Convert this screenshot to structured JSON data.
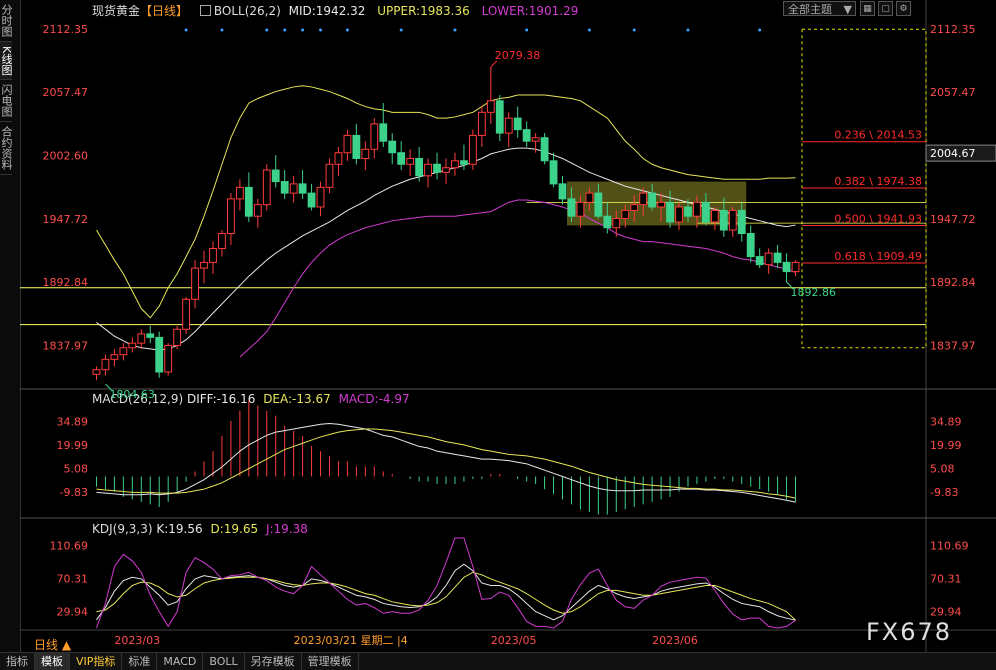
{
  "sidebar_tabs": [
    "分时图",
    "K线图",
    "闪电图",
    "合约资料"
  ],
  "active_sidebar_tab": 1,
  "header": {
    "symbol": "现货黄金",
    "period": "【日线】",
    "boll_label": "BOLL(26,2)",
    "mid": "MID:1942.32",
    "upper": "UPPER:1983.36",
    "lower": "LOWER:1901.29",
    "theme_label": "全部主题"
  },
  "macd_header": {
    "label": "MACD(26,12,9)",
    "diff": "DIFF:-16.16",
    "dea": "DEA:-13.67",
    "macd": "MACD:-4.97"
  },
  "kdj_header": {
    "label": "KDJ(9,3,3)",
    "k": "K:19.56",
    "d": "D:19.65",
    "j": "J:19.38"
  },
  "x_axis": {
    "period_label": "日线",
    "labels": [
      "2023/03",
      "2023/03/21 星期二 |4",
      "2023/05",
      "2023/06"
    ]
  },
  "bottom_tabs": [
    "指标",
    "模板",
    "VIP指标",
    "标准",
    "MACD",
    "BOLL",
    "另存模板",
    "管理模板"
  ],
  "active_bottom_tab": 1,
  "watermark": "FX678",
  "current_price_tag": "2004.67",
  "colors": {
    "up": "#ff3b3b",
    "down": "#3dd28c",
    "mid": "#e8e8e8",
    "upper": "#e6e65a",
    "lower": "#d23cd2",
    "fib": "#ff2b2b",
    "level": "#ffff66",
    "axis_text": "#ff4d4d",
    "box": "#6b6b1f"
  },
  "chart_data": {
    "type": "candlestick",
    "main": {
      "y_ticks": [
        2112.35,
        2057.47,
        2002.6,
        1947.72,
        1892.84,
        1837.97
      ],
      "ylim": [
        1815,
        2120
      ],
      "candles_ohlc": [
        [
          1813,
          1820,
          1808,
          1817
        ],
        [
          1817,
          1830,
          1812,
          1826
        ],
        [
          1826,
          1835,
          1820,
          1830
        ],
        [
          1830,
          1840,
          1825,
          1836
        ],
        [
          1836,
          1845,
          1832,
          1840
        ],
        [
          1840,
          1852,
          1835,
          1848
        ],
        [
          1848,
          1855,
          1840,
          1845
        ],
        [
          1845,
          1850,
          1810,
          1815
        ],
        [
          1815,
          1840,
          1812,
          1838
        ],
        [
          1838,
          1855,
          1835,
          1852
        ],
        [
          1852,
          1880,
          1848,
          1878
        ],
        [
          1878,
          1912,
          1870,
          1905
        ],
        [
          1905,
          1920,
          1892,
          1910
        ],
        [
          1910,
          1928,
          1900,
          1922
        ],
        [
          1922,
          1938,
          1915,
          1935
        ],
        [
          1935,
          1970,
          1925,
          1965
        ],
        [
          1965,
          1982,
          1955,
          1975
        ],
        [
          1975,
          1988,
          1945,
          1950
        ],
        [
          1950,
          1965,
          1940,
          1960
        ],
        [
          1960,
          1995,
          1955,
          1990
        ],
        [
          1990,
          2003,
          1975,
          1980
        ],
        [
          1980,
          1990,
          1965,
          1970
        ],
        [
          1970,
          1985,
          1962,
          1978
        ],
        [
          1978,
          1990,
          1965,
          1970
        ],
        [
          1970,
          1978,
          1955,
          1958
        ],
        [
          1958,
          1980,
          1950,
          1975
        ],
        [
          1975,
          2000,
          1970,
          1995
        ],
        [
          1995,
          2010,
          1985,
          2005
        ],
        [
          2005,
          2025,
          1998,
          2020
        ],
        [
          2020,
          2030,
          1995,
          2000
        ],
        [
          2000,
          2015,
          1990,
          2008
        ],
        [
          2008,
          2035,
          2000,
          2030
        ],
        [
          2030,
          2048,
          2010,
          2015
        ],
        [
          2015,
          2022,
          1995,
          2005
        ],
        [
          2005,
          2015,
          1990,
          1995
        ],
        [
          1995,
          2008,
          1985,
          2000
        ],
        [
          2000,
          2010,
          1980,
          1985
        ],
        [
          1985,
          2000,
          1975,
          1995
        ],
        [
          1995,
          2005,
          1982,
          1988
        ],
        [
          1988,
          2000,
          1978,
          1992
        ],
        [
          1992,
          2005,
          1985,
          1998
        ],
        [
          1998,
          2012,
          1990,
          1995
        ],
        [
          1995,
          2025,
          1990,
          2020
        ],
        [
          2020,
          2045,
          2010,
          2040
        ],
        [
          2040,
          2079.38,
          2030,
          2050
        ],
        [
          2050,
          2055,
          2015,
          2022
        ],
        [
          2022,
          2040,
          2010,
          2035
        ],
        [
          2035,
          2045,
          2018,
          2025
        ],
        [
          2025,
          2032,
          2010,
          2015
        ],
        [
          2015,
          2022,
          2005,
          2018
        ],
        [
          2018,
          2022,
          1995,
          1998
        ],
        [
          1998,
          2005,
          1975,
          1978
        ],
        [
          1978,
          1985,
          1960,
          1965
        ],
        [
          1965,
          1975,
          1945,
          1950
        ],
        [
          1950,
          1968,
          1940,
          1962
        ],
        [
          1962,
          1975,
          1955,
          1970
        ],
        [
          1970,
          1978,
          1948,
          1950
        ],
        [
          1950,
          1962,
          1935,
          1940
        ],
        [
          1940,
          1955,
          1932,
          1948
        ],
        [
          1948,
          1960,
          1940,
          1955
        ],
        [
          1955,
          1968,
          1945,
          1960
        ],
        [
          1960,
          1975,
          1950,
          1970
        ],
        [
          1970,
          1978,
          1955,
          1958
        ],
        [
          1958,
          1970,
          1945,
          1962
        ],
        [
          1962,
          1972,
          1940,
          1945
        ],
        [
          1945,
          1962,
          1938,
          1958
        ],
        [
          1958,
          1965,
          1945,
          1950
        ],
        [
          1950,
          1968,
          1940,
          1962
        ],
        [
          1962,
          1970,
          1942,
          1945
        ],
        [
          1945,
          1958,
          1938,
          1955
        ],
        [
          1955,
          1966,
          1932,
          1938
        ],
        [
          1938,
          1958,
          1932,
          1955
        ],
        [
          1955,
          1962,
          1928,
          1935
        ],
        [
          1935,
          1942,
          1910,
          1915
        ],
        [
          1915,
          1922,
          1905,
          1908
        ],
        [
          1908,
          1922,
          1900,
          1918
        ],
        [
          1918,
          1925,
          1905,
          1910
        ],
        [
          1910,
          1918,
          1892.86,
          1902
        ],
        [
          1902,
          1912,
          1898,
          1910
        ]
      ],
      "mid_line": [
        1858,
        1852,
        1846,
        1842,
        1838,
        1836,
        1835,
        1834,
        1835,
        1838,
        1843,
        1850,
        1858,
        1866,
        1874,
        1882,
        1890,
        1898,
        1905,
        1912,
        1918,
        1923,
        1928,
        1933,
        1937,
        1941,
        1945,
        1950,
        1955,
        1959,
        1963,
        1968,
        1972,
        1976,
        1979,
        1982,
        1984,
        1986,
        1988,
        1990,
        1992,
        1994,
        1997,
        2000,
        2004,
        2006,
        2008,
        2009,
        2009,
        2008,
        2006,
        2003,
        2000,
        1996,
        1992,
        1988,
        1985,
        1982,
        1979,
        1976,
        1974,
        1972,
        1970,
        1968,
        1966,
        1964,
        1962,
        1960,
        1958,
        1956,
        1954,
        1952,
        1950,
        1948,
        1946,
        1944,
        1942,
        1941,
        1942.32
      ],
      "upper_line": [
        1938,
        1925,
        1912,
        1900,
        1885,
        1870,
        1862,
        1872,
        1888,
        1900,
        1915,
        1930,
        1950,
        1972,
        1995,
        2018,
        2035,
        2048,
        2052,
        2055,
        2058,
        2060,
        2062,
        2063,
        2062,
        2060,
        2058,
        2055,
        2052,
        2048,
        2045,
        2043,
        2042,
        2040,
        2040,
        2040,
        2040,
        2038,
        2035,
        2035,
        2036,
        2038,
        2040,
        2045,
        2050,
        2052,
        2053,
        2055,
        2055,
        2055,
        2055,
        2054,
        2053,
        2052,
        2050,
        2045,
        2040,
        2035,
        2025,
        2015,
        2008,
        2000,
        1995,
        1992,
        1990,
        1988,
        1986,
        1985,
        1984,
        1983,
        1982,
        1982,
        1982,
        1982,
        1982,
        1983,
        1983,
        1983,
        1983.36
      ],
      "lower_line": [
        null,
        null,
        null,
        null,
        null,
        null,
        null,
        null,
        null,
        null,
        null,
        null,
        null,
        null,
        null,
        null,
        1828,
        1835,
        1842,
        1850,
        1862,
        1875,
        1888,
        1900,
        1910,
        1918,
        1925,
        1930,
        1934,
        1937,
        1940,
        1942,
        1944,
        1946,
        1947,
        1948,
        1949,
        1950,
        1950,
        1950,
        1950,
        1951,
        1952,
        1953,
        1954,
        1958,
        1962,
        1964,
        1964,
        1963,
        1962,
        1960,
        1958,
        1955,
        1953,
        1948,
        1944,
        1940,
        1935,
        1932,
        1930,
        1928,
        1928,
        1927,
        1926,
        1925,
        1924,
        1923,
        1922,
        1920,
        1918,
        1915,
        1913,
        1912,
        1910,
        1908,
        1906,
        1904,
        1901.29
      ],
      "annotations": [
        {
          "type": "high",
          "label": "2079.38",
          "index": 44,
          "value": 2079.38
        },
        {
          "type": "low",
          "label": "1804.63",
          "index": 1,
          "value": 1804.63
        },
        {
          "type": "low",
          "label": "1892.86",
          "index": 77,
          "value": 1892.86
        }
      ],
      "fib_levels": [
        {
          "label": "0.236 \\ 2014.53",
          "value": 2014.53
        },
        {
          "label": "0.382 \\ 1974.38",
          "value": 1974.38
        },
        {
          "label": "0.500 \\ 1941.93",
          "value": 1941.93
        },
        {
          "label": "0.618 \\ 1909.49",
          "value": 1909.49
        }
      ],
      "horizontal_levels": [
        1888,
        1856
      ],
      "consolidation_box": {
        "from_index": 53,
        "to_index": 72,
        "low": 1942,
        "high": 1980
      }
    },
    "macd": {
      "y_ticks": [
        34.89,
        19.99,
        5.08,
        -9.83
      ],
      "ylim": [
        -18,
        42
      ],
      "histogram": [
        -2,
        -2.5,
        -3,
        -4,
        -4.5,
        -5,
        -5.5,
        -6,
        -5,
        -3,
        -1,
        1,
        3,
        5,
        8,
        11,
        13,
        15,
        14,
        13,
        12,
        10,
        9,
        8,
        6,
        5,
        4,
        3,
        3,
        2,
        2,
        2,
        1,
        0.5,
        0,
        -0.5,
        -1,
        -1,
        -1.5,
        -1.5,
        -1.5,
        -1,
        -0.5,
        -0.5,
        0.5,
        0.5,
        0,
        -0.5,
        -1,
        -1.5,
        -2.5,
        -3.5,
        -4.5,
        -5.5,
        -6.5,
        -7,
        -7.5,
        -7.5,
        -7,
        -6.5,
        -6,
        -5.5,
        -5,
        -4.5,
        -4,
        -3,
        -2,
        -1.5,
        -1,
        -0.5,
        -0.5,
        -1,
        -1.5,
        -2,
        -2.5,
        -3,
        -3.5,
        -4.5,
        -4.97
      ],
      "diff": [
        -10,
        -10.5,
        -11,
        -11.5,
        -11.5,
        -11.5,
        -11,
        -11.5,
        -11,
        -10,
        -8,
        -5,
        -2,
        2,
        6,
        11,
        16,
        20,
        23,
        26,
        28,
        29,
        30,
        31,
        32,
        33,
        33.5,
        33,
        32,
        31,
        30,
        28,
        26,
        25,
        23,
        21,
        19,
        18,
        16,
        15,
        14,
        13,
        12,
        11,
        11,
        10.5,
        10,
        9,
        8,
        6,
        4,
        2,
        0,
        -2,
        -4,
        -6,
        -7.5,
        -8.5,
        -9,
        -9,
        -9,
        -8.5,
        -8.5,
        -8.5,
        -8.5,
        -8,
        -8,
        -8,
        -8.5,
        -8.5,
        -9,
        -9.5,
        -10,
        -11,
        -12,
        -13,
        -14,
        -15,
        -16.16
      ],
      "dea": [
        -8,
        -8.5,
        -9,
        -9.5,
        -10,
        -10,
        -10,
        -10.5,
        -10.5,
        -10.5,
        -10,
        -9,
        -8,
        -6,
        -4,
        -1,
        2,
        5,
        8,
        11,
        14,
        17,
        19,
        21,
        23,
        25,
        26.5,
        28,
        29,
        29.5,
        30,
        30,
        29.5,
        29,
        28,
        27,
        26,
        25,
        23.5,
        22,
        21,
        20,
        18.5,
        17,
        16,
        15,
        14,
        13.5,
        13,
        12,
        11,
        9.5,
        8,
        6.5,
        4.5,
        2.5,
        1,
        -0.5,
        -2,
        -3,
        -4,
        -5,
        -5.5,
        -6,
        -6.5,
        -7,
        -7.5,
        -7.5,
        -8,
        -8,
        -8.5,
        -8.5,
        -9,
        -9.5,
        -10,
        -11,
        -11.5,
        -12.5,
        -13.67
      ]
    },
    "kdj": {
      "y_ticks": [
        110.69,
        70.31,
        29.94
      ],
      "ylim": [
        10,
        120
      ],
      "k": [
        20,
        35,
        55,
        68,
        72,
        70,
        60,
        50,
        38,
        42,
        58,
        70,
        74,
        72,
        70,
        72,
        73,
        74,
        72,
        70,
        66,
        62,
        60,
        62,
        70,
        68,
        65,
        60,
        55,
        50,
        48,
        45,
        40,
        38,
        36,
        35,
        36,
        40,
        48,
        62,
        80,
        88,
        80,
        65,
        62,
        62,
        58,
        50,
        40,
        30,
        25,
        20,
        25,
        35,
        45,
        55,
        62,
        58,
        52,
        48,
        46,
        48,
        50,
        55,
        58,
        60,
        62,
        64,
        65,
        60,
        52,
        45,
        40,
        38,
        36,
        30,
        25,
        22,
        19.56
      ],
      "d": [
        30,
        32,
        40,
        52,
        62,
        66,
        65,
        60,
        52,
        48,
        50,
        58,
        65,
        68,
        70,
        71,
        72,
        72,
        72,
        70,
        68,
        65,
        63,
        62,
        64,
        65,
        65,
        63,
        60,
        56,
        52,
        50,
        46,
        42,
        40,
        38,
        37,
        38,
        41,
        48,
        60,
        72,
        78,
        75,
        70,
        66,
        62,
        58,
        52,
        45,
        38,
        32,
        28,
        30,
        36,
        44,
        52,
        56,
        56,
        54,
        52,
        50,
        50,
        52,
        54,
        56,
        58,
        60,
        62,
        62,
        58,
        54,
        50,
        46,
        43,
        40,
        35,
        30,
        19.65
      ],
      "j": [
        10,
        40,
        85,
        100,
        92,
        78,
        50,
        30,
        12,
        30,
        78,
        96,
        90,
        82,
        70,
        74,
        75,
        78,
        72,
        68,
        60,
        55,
        52,
        62,
        85,
        75,
        65,
        55,
        45,
        38,
        40,
        35,
        28,
        30,
        28,
        28,
        32,
        44,
        62,
        90,
        120,
        120,
        85,
        45,
        46,
        54,
        50,
        35,
        18,
        12,
        12,
        10,
        18,
        45,
        63,
        77,
        82,
        62,
        44,
        36,
        34,
        44,
        50,
        61,
        66,
        68,
        70,
        72,
        71,
        56,
        40,
        27,
        20,
        22,
        22,
        12,
        10,
        12,
        19.38
      ]
    }
  }
}
